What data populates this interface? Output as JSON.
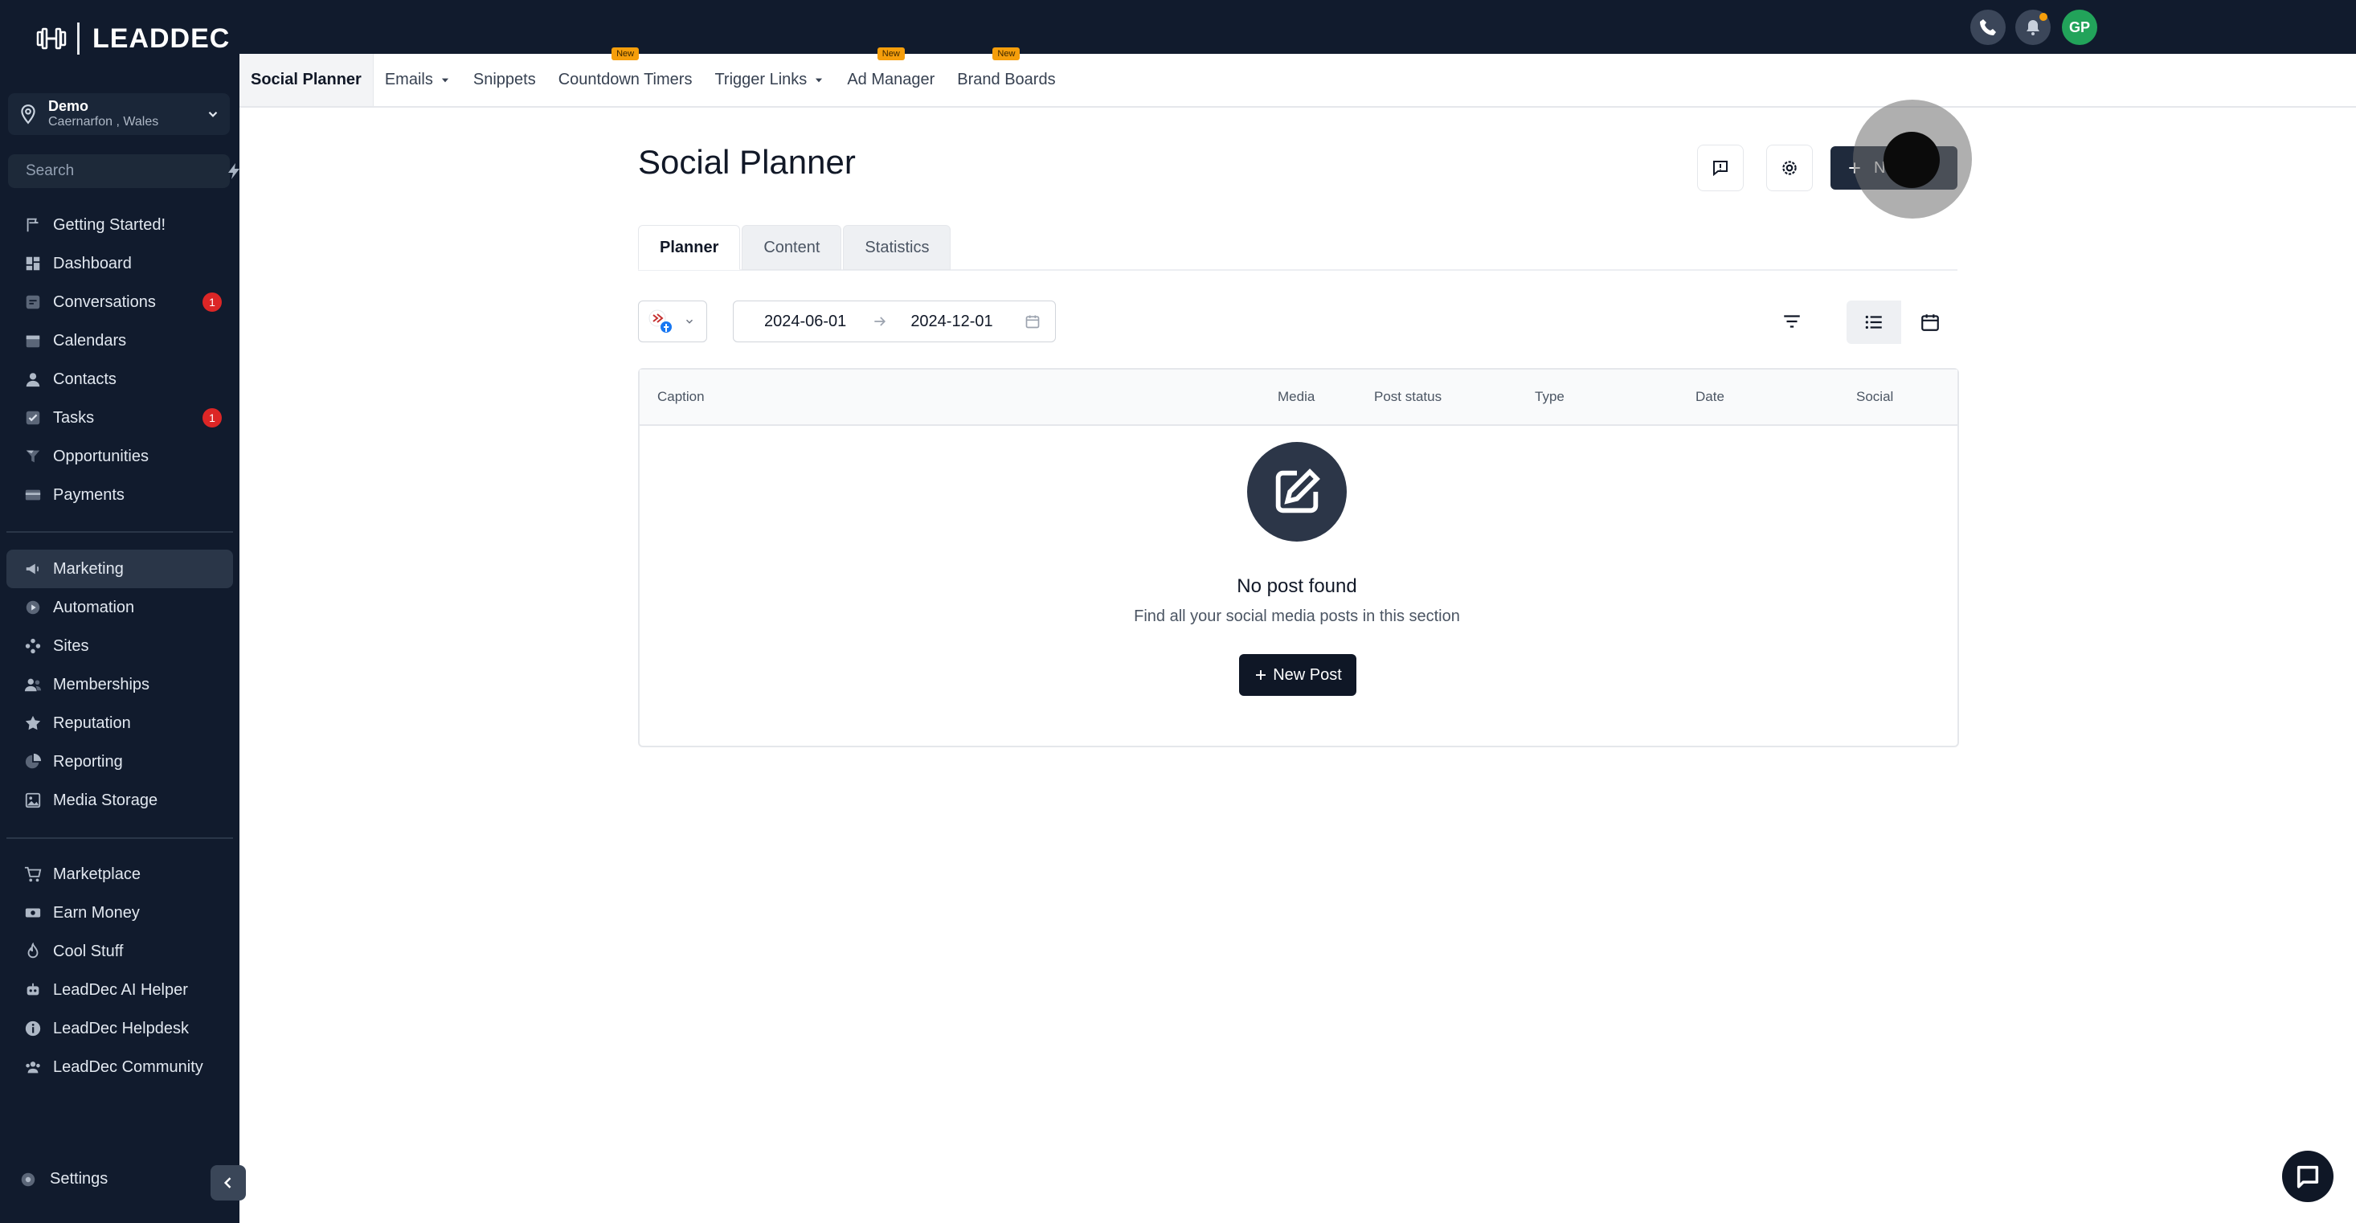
{
  "brand": {
    "name": "LEADDEC"
  },
  "location": {
    "name": "Demo",
    "sub": "Caernarfon , Wales"
  },
  "search": {
    "placeholder": "Search"
  },
  "sidebar": {
    "group1": [
      {
        "label": "Getting Started!",
        "icon": "flag-icon"
      },
      {
        "label": "Dashboard",
        "icon": "dashboard-icon"
      },
      {
        "label": "Conversations",
        "icon": "chat-icon",
        "badge": "1"
      },
      {
        "label": "Calendars",
        "icon": "calendar-icon"
      },
      {
        "label": "Contacts",
        "icon": "person-icon"
      },
      {
        "label": "Tasks",
        "icon": "checkbox-icon",
        "badge": "1"
      },
      {
        "label": "Opportunities",
        "icon": "filter-funnel-icon"
      },
      {
        "label": "Payments",
        "icon": "card-icon"
      }
    ],
    "group2": [
      {
        "label": "Marketing",
        "icon": "megaphone-icon",
        "active": true
      },
      {
        "label": "Automation",
        "icon": "play-icon"
      },
      {
        "label": "Sites",
        "icon": "sitemap-icon"
      },
      {
        "label": "Memberships",
        "icon": "users-icon"
      },
      {
        "label": "Reputation",
        "icon": "star-icon"
      },
      {
        "label": "Reporting",
        "icon": "pie-chart-icon"
      },
      {
        "label": "Media Storage",
        "icon": "image-icon"
      }
    ],
    "group3": [
      {
        "label": "Marketplace",
        "icon": "cart-icon"
      },
      {
        "label": "Earn Money",
        "icon": "money-icon"
      },
      {
        "label": "Cool Stuff",
        "icon": "flame-icon"
      },
      {
        "label": "LeadDec AI Helper",
        "icon": "robot-icon"
      },
      {
        "label": "LeadDec Helpdesk",
        "icon": "info-icon"
      },
      {
        "label": "LeadDec Community",
        "icon": "community-icon"
      }
    ],
    "settings_label": "Settings"
  },
  "topbar": {
    "avatar_initials": "GP"
  },
  "subnav": [
    {
      "label": "Social Planner",
      "active": true
    },
    {
      "label": "Emails",
      "dropdown": true
    },
    {
      "label": "Snippets"
    },
    {
      "label": "Countdown Timers",
      "badge": "New"
    },
    {
      "label": "Trigger Links",
      "dropdown": true
    },
    {
      "label": "Ad Manager",
      "badge": "New"
    },
    {
      "label": "Brand Boards",
      "badge": "New"
    }
  ],
  "page": {
    "title": "Social Planner",
    "new_post_top_label": "N",
    "tabs": [
      "Planner",
      "Content",
      "Statistics"
    ],
    "date_start": "2024-06-01",
    "date_end": "2024-12-01",
    "columns": [
      "Caption",
      "Media",
      "Post status",
      "Type",
      "Date",
      "Social"
    ],
    "empty_title": "No post found",
    "empty_subtitle": "Find all your social media posts in this section",
    "new_post_label": "New Post"
  },
  "colors": {
    "sidebar_bg": "#111b2d",
    "badge": "#dc2626",
    "new_badge": "#f59e0b",
    "avatar": "#22a35a"
  }
}
